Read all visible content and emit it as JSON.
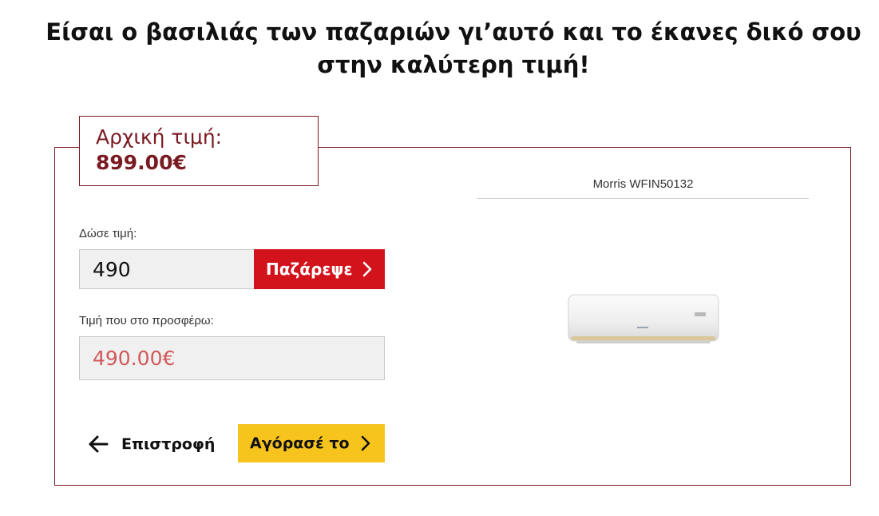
{
  "headline": "Είσαι ο βασιλιάς των παζαριών γι’αυτό και το έκανες δικό σου στην καλύτερη τιμή!",
  "original_price": {
    "label": "Αρχική τιμή:",
    "value": "899.00€"
  },
  "offer": {
    "label": "Δώσε τιμή:",
    "input_value": "490",
    "button_label": "Παζάρεψε",
    "button_icon": "chevron-right-icon"
  },
  "result": {
    "label": "Τιμή που στο προσφέρω:",
    "value": "490.00€"
  },
  "actions": {
    "back_label": "Επιστροφή",
    "back_icon": "arrow-left-icon",
    "buy_label": "Αγόρασέ το",
    "buy_icon": "chevron-right-icon"
  },
  "product": {
    "name": "Morris WFIN50132",
    "image": "air-conditioner-unit"
  },
  "colors": {
    "brand_dark_red": "#7a1a22",
    "bargain_button": "#d3131b",
    "buy_button": "#f7c41d",
    "result_text": "#d25a5a",
    "field_background": "#f0f0f0"
  }
}
